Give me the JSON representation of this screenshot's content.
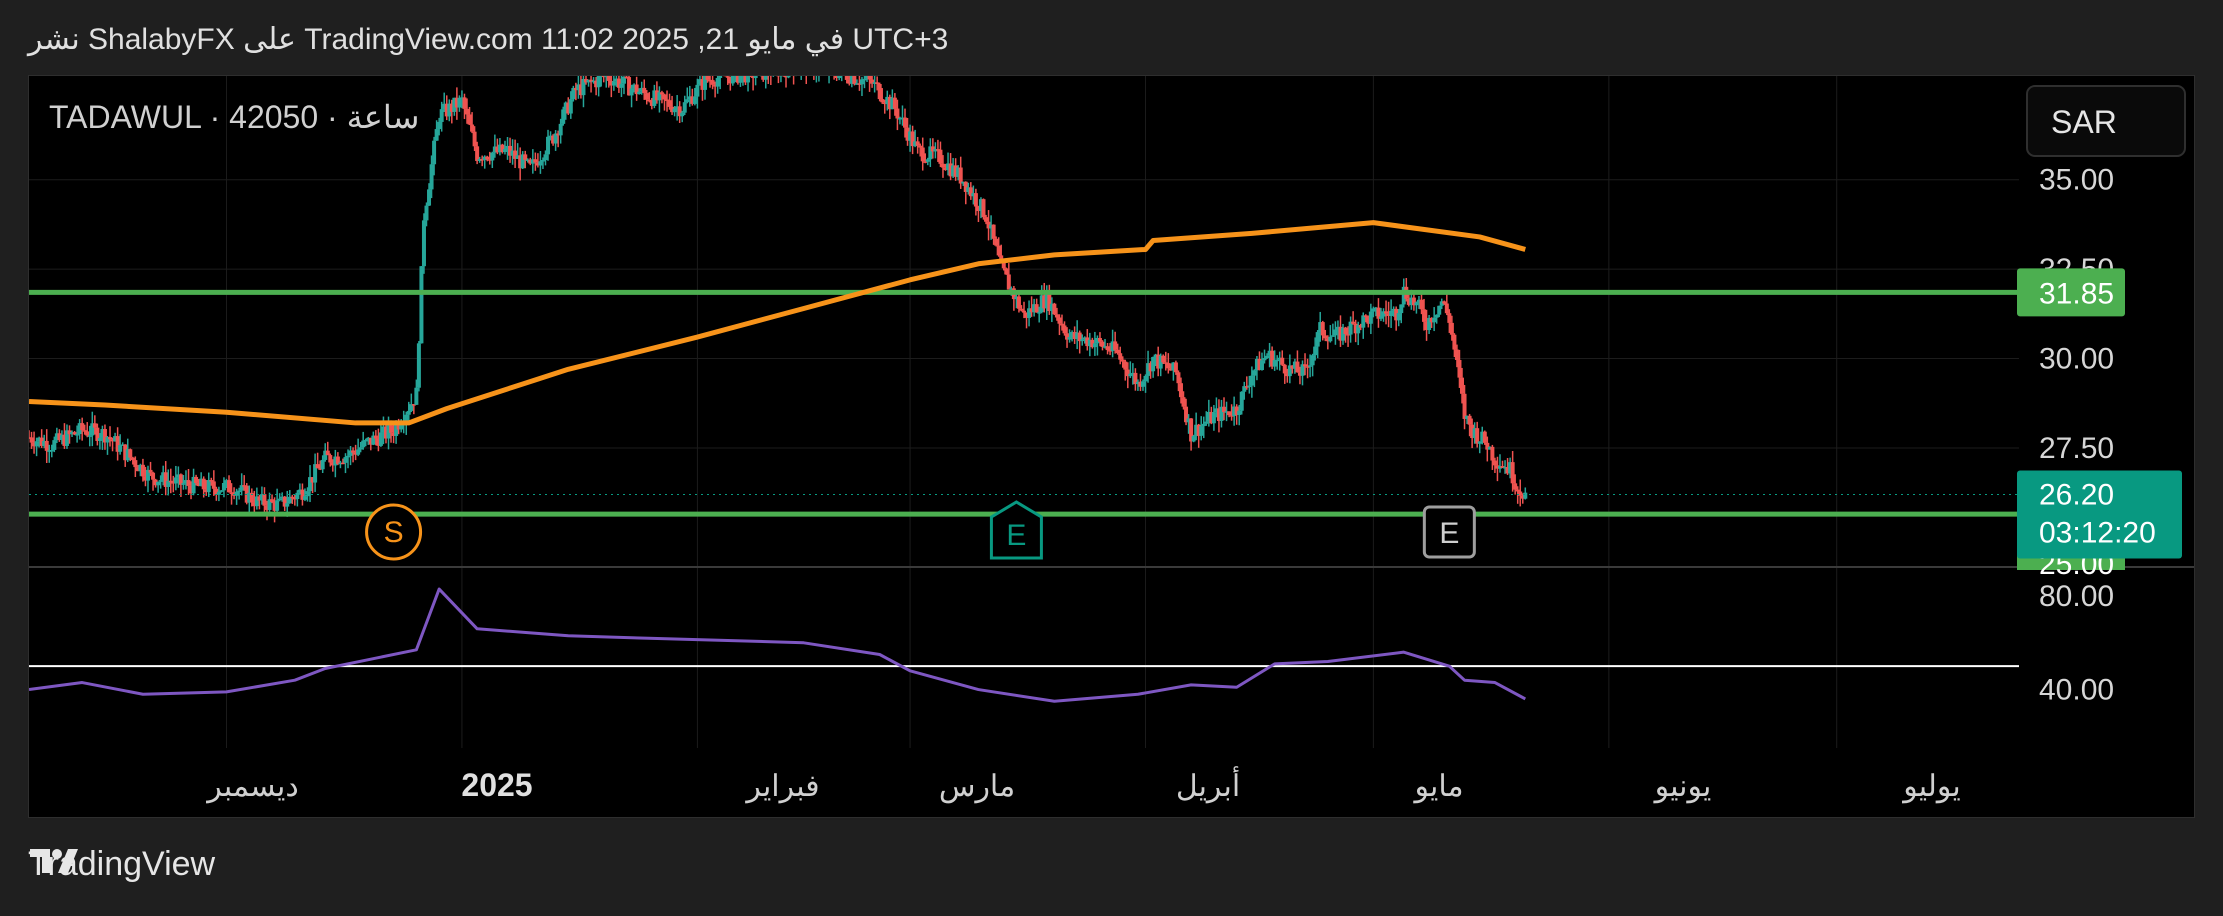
{
  "header": {
    "text": "نشر ShalabyFX على TradingView.com 11:02 2025 ,21 في مايو UTC+3"
  },
  "symbol": {
    "text": "TADAWUL · 4ساعة · 2050"
  },
  "currency_button": {
    "label": "SAR"
  },
  "price_axis": {
    "ticks": [
      "35.00",
      "32.50",
      "30.00",
      "27.50"
    ],
    "level_label": "31.85",
    "current_price": "26.20",
    "countdown": "03:12:20",
    "partial_label": "25.00"
  },
  "rsi_axis": {
    "ticks": [
      "80.00",
      "40.00"
    ]
  },
  "time_axis": {
    "labels": [
      "ديسمبر",
      "2025",
      "فبراير",
      "مارس",
      "أبريل",
      "مايو",
      "يونيو",
      "يوليو"
    ]
  },
  "markers": {
    "s": "S",
    "e1": "E",
    "e2": "E"
  },
  "footer": {
    "brand": "TradingView"
  },
  "colors": {
    "background": "#000000",
    "up_candle": "#26a69a",
    "down_candle": "#ef5350",
    "moving_average": "#f7931a",
    "horizontal_levels": "#4caf50",
    "rsi_line": "#7e57c2",
    "current_price_badge": "#089981"
  },
  "chart_data": [
    {
      "type": "candlestick",
      "title": "TADAWUL · 4ساعة · 2050",
      "currency": "SAR",
      "x_range": [
        "2024-11-05",
        "2025-07-25"
      ],
      "ylim": [
        24.2,
        37.9
      ],
      "y_ticks": [
        27.5,
        30.0,
        32.5,
        35.0
      ],
      "last_price": 26.2,
      "horizontal_levels": [
        31.85,
        25.65
      ],
      "close_path": [
        [
          "2024-11-05",
          27.8
        ],
        [
          "2024-11-08",
          27.6
        ],
        [
          "2024-11-12",
          28.0
        ],
        [
          "2024-11-15",
          27.9
        ],
        [
          "2024-11-18",
          27.3
        ],
        [
          "2024-11-21",
          26.7
        ],
        [
          "2024-11-25",
          26.5
        ],
        [
          "2024-11-28",
          26.4
        ],
        [
          "2024-12-02",
          26.4
        ],
        [
          "2024-12-05",
          26.0
        ],
        [
          "2024-12-08",
          25.9
        ],
        [
          "2024-12-11",
          26.3
        ],
        [
          "2024-12-14",
          27.2
        ],
        [
          "2024-12-17",
          27.3
        ],
        [
          "2024-12-20",
          27.7
        ],
        [
          "2024-12-23",
          28.0
        ],
        [
          "2024-12-26",
          29.0
        ],
        [
          "2024-12-27",
          34.0
        ],
        [
          "2024-12-29",
          36.8
        ],
        [
          "2025-01-01",
          37.2
        ],
        [
          "2025-01-03",
          35.7
        ],
        [
          "2025-01-07",
          35.8
        ],
        [
          "2025-01-10",
          35.3
        ],
        [
          "2025-01-13",
          36.2
        ],
        [
          "2025-01-16",
          37.5
        ],
        [
          "2025-01-20",
          37.9
        ],
        [
          "2025-01-23",
          37.6
        ],
        [
          "2025-01-27",
          37.2
        ],
        [
          "2025-01-30",
          37.0
        ],
        [
          "2025-02-02",
          37.8
        ],
        [
          "2025-02-05",
          37.9
        ],
        [
          "2025-02-10",
          38.0
        ],
        [
          "2025-02-15",
          38.2
        ],
        [
          "2025-02-20",
          38.0
        ],
        [
          "2025-02-24",
          37.7
        ],
        [
          "2025-02-27",
          37.0
        ],
        [
          "2025-03-02",
          35.8
        ],
        [
          "2025-03-05",
          35.6
        ],
        [
          "2025-03-08",
          35.0
        ],
        [
          "2025-03-11",
          34.0
        ],
        [
          "2025-03-13",
          32.5
        ],
        [
          "2025-03-16",
          31.2
        ],
        [
          "2025-03-19",
          31.7
        ],
        [
          "2025-03-22",
          30.6
        ],
        [
          "2025-03-25",
          30.5
        ],
        [
          "2025-03-28",
          30.2
        ],
        [
          "2025-03-31",
          29.3
        ],
        [
          "2025-04-02",
          30.0
        ],
        [
          "2025-04-05",
          29.6
        ],
        [
          "2025-04-07",
          27.9
        ],
        [
          "2025-04-10",
          28.4
        ],
        [
          "2025-04-13",
          28.6
        ],
        [
          "2025-04-15",
          29.6
        ],
        [
          "2025-04-17",
          30.1
        ],
        [
          "2025-04-20",
          29.7
        ],
        [
          "2025-04-22",
          29.6
        ],
        [
          "2025-04-24",
          30.8
        ],
        [
          "2025-04-26",
          30.6
        ],
        [
          "2025-04-29",
          31.0
        ],
        [
          "2025-05-01",
          31.2
        ],
        [
          "2025-05-04",
          31.3
        ],
        [
          "2025-05-05",
          31.9
        ],
        [
          "2025-05-07",
          31.4
        ],
        [
          "2025-05-08",
          31.0
        ],
        [
          "2025-05-10",
          31.6
        ],
        [
          "2025-05-11",
          31.1
        ],
        [
          "2025-05-12",
          29.8
        ],
        [
          "2025-05-13",
          28.4
        ],
        [
          "2025-05-14",
          28.0
        ],
        [
          "2025-05-15",
          27.8
        ],
        [
          "2025-05-16",
          27.6
        ],
        [
          "2025-05-17",
          27.2
        ],
        [
          "2025-05-19",
          26.9
        ],
        [
          "2025-05-20",
          26.4
        ],
        [
          "2025-05-21",
          26.2
        ]
      ],
      "series": [
        {
          "name": "moving average",
          "x": [
            "2024-11-05",
            "2024-11-15",
            "2024-12-01",
            "2024-12-18",
            "2024-12-25",
            "2024-12-30",
            "2025-01-15",
            "2025-02-01",
            "2025-02-15",
            "2025-03-01",
            "2025-03-10",
            "2025-03-20",
            "2025-04-01",
            "2025-04-02",
            "2025-04-15",
            "2025-05-01",
            "2025-05-15",
            "2025-05-21"
          ],
          "values": [
            28.8,
            28.7,
            28.5,
            28.2,
            28.2,
            28.6,
            29.7,
            30.6,
            31.4,
            32.2,
            32.65,
            32.9,
            33.05,
            33.3,
            33.5,
            33.8,
            33.4,
            33.05
          ]
        }
      ],
      "markers": [
        {
          "label": "S",
          "x": "2024-12-23"
        },
        {
          "label": "E",
          "x": "2025-03-15"
        },
        {
          "label": "E",
          "x": "2025-05-11"
        }
      ],
      "x_tick_labels": [
        "ديسمبر",
        "2025",
        "فبراير",
        "مارس",
        "أبريل",
        "مايو",
        "يونيو",
        "يوليو"
      ]
    },
    {
      "type": "line",
      "series": [
        {
          "name": "RSI",
          "x": [
            "2024-11-05",
            "2024-11-12",
            "2024-11-20",
            "2024-12-01",
            "2024-12-10",
            "2024-12-14",
            "2024-12-20",
            "2024-12-26",
            "2024-12-29",
            "2025-01-03",
            "2025-01-15",
            "2025-01-25",
            "2025-02-05",
            "2025-02-15",
            "2025-02-25",
            "2025-03-01",
            "2025-03-10",
            "2025-03-20",
            "2025-03-31",
            "2025-04-07",
            "2025-04-13",
            "2025-04-18",
            "2025-04-25",
            "2025-05-05",
            "2025-05-11",
            "2025-05-13",
            "2025-05-17",
            "2025-05-21"
          ],
          "values": [
            40,
            43,
            38,
            39,
            44,
            49,
            53,
            57,
            83,
            66,
            63,
            62,
            61,
            60,
            55,
            48,
            40,
            35,
            38,
            42,
            41,
            51,
            52,
            56,
            50,
            44,
            43,
            36
          ]
        }
      ],
      "ylim": [
        15,
        92
      ],
      "y_ticks": [
        40,
        80
      ],
      "reference_line": 50
    }
  ]
}
